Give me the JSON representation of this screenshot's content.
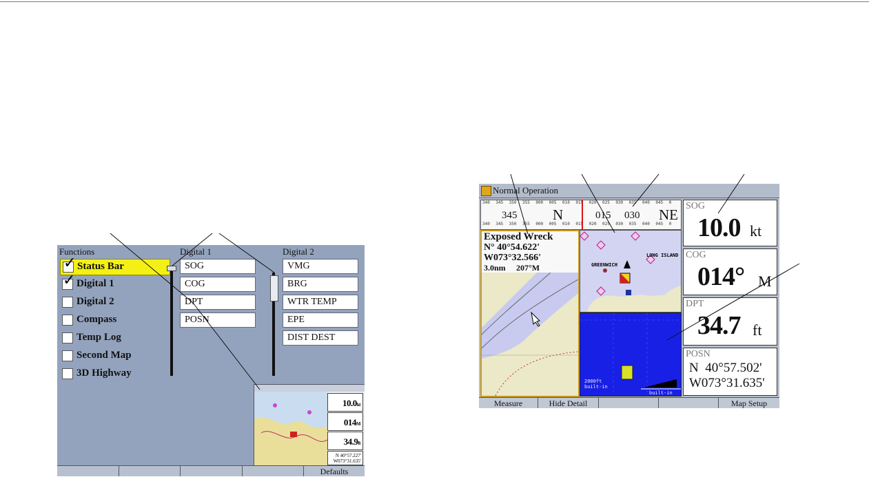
{
  "left_screen": {
    "headers": {
      "functions": "Functions",
      "digital1": "Digital 1",
      "digital2": "Digital 2"
    },
    "functions": [
      {
        "label": "Status Bar",
        "checked": true,
        "selected": true
      },
      {
        "label": "Digital 1",
        "checked": true,
        "selected": false
      },
      {
        "label": "Digital 2",
        "checked": false,
        "selected": false
      },
      {
        "label": "Compass",
        "checked": false,
        "selected": false
      },
      {
        "label": "Temp Log",
        "checked": false,
        "selected": false
      },
      {
        "label": "Second Map",
        "checked": false,
        "selected": false
      },
      {
        "label": "3D Highway",
        "checked": false,
        "selected": false
      }
    ],
    "digital1": [
      "SOG",
      "COG",
      "DPT",
      "POSN"
    ],
    "digital2": [
      "VMG",
      "BRG",
      "WTR TEMP",
      "EPE",
      "DIST DEST"
    ],
    "preview": {
      "values": [
        {
          "num": "10.0",
          "unit": "kt"
        },
        {
          "num": "014",
          "unit": "M"
        },
        {
          "num": "34.9",
          "unit": "ft"
        }
      ],
      "posn": [
        "N 40°57.227'",
        "W073°31.635'"
      ]
    },
    "softkeys": [
      "",
      "",
      "",
      "",
      "Defaults"
    ]
  },
  "right_screen": {
    "title": "Normal Operation",
    "compass": {
      "top_ticks": [
        "340",
        "345",
        "350",
        "355",
        "000",
        "005",
        "010",
        "015",
        "020",
        "025",
        "030",
        "035",
        "040",
        "045",
        "0"
      ],
      "labels": [
        "345",
        "N",
        "015",
        "030",
        "NE"
      ]
    },
    "waypoint": {
      "name": "Exposed Wreck",
      "lat": "N° 40°54.622'",
      "lon": "W073°32.566'",
      "dist": "3.0nm",
      "brg": "207°M"
    },
    "map_labels": {
      "greenwich": "GREENWICH",
      "long_island": "LONG ISLAND",
      "scale1": "2000ft",
      "scale2": "built-in",
      "scale3": "built-in"
    },
    "data_fields": [
      {
        "label": "SOG",
        "value": "10.0",
        "unit": "kt"
      },
      {
        "label": "COG",
        "value": "014°",
        "unit": "M"
      },
      {
        "label": "DPT",
        "value": "34.7",
        "unit": "ft"
      }
    ],
    "posn": {
      "label": "POSN",
      "lat": "N  40°57.502'",
      "lon": "W073°31.635'"
    },
    "softkeys": [
      "Measure",
      "Hide Detail",
      "",
      "",
      "Map Setup"
    ]
  },
  "colors": {
    "screen_bg": "#94a3bd",
    "highlight": "#f4f015",
    "sonar": "#1820e6",
    "land": "#ece9c8",
    "water": "#c8cbef"
  }
}
